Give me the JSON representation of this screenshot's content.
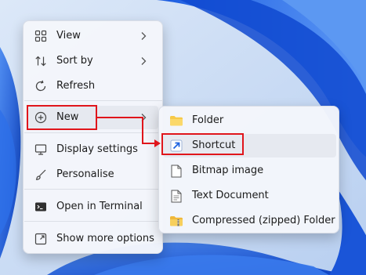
{
  "context_menu": {
    "items": [
      {
        "label": "View",
        "icon": "view-grid-icon",
        "has_submenu": true
      },
      {
        "label": "Sort by",
        "icon": "sort-arrows-icon",
        "has_submenu": true
      },
      {
        "label": "Refresh",
        "icon": "refresh-icon",
        "has_submenu": false
      },
      {
        "label": "New",
        "icon": "plus-circle-icon",
        "has_submenu": true,
        "highlighted": true
      },
      {
        "label": "Display settings",
        "icon": "display-icon",
        "has_submenu": false
      },
      {
        "label": "Personalise",
        "icon": "brush-icon",
        "has_submenu": false
      },
      {
        "label": "Open in Terminal",
        "icon": "terminal-icon",
        "has_submenu": false
      },
      {
        "label": "Show more options",
        "icon": "show-more-icon",
        "has_submenu": false
      }
    ]
  },
  "new_submenu": {
    "items": [
      {
        "label": "Folder",
        "icon": "folder-icon"
      },
      {
        "label": "Shortcut",
        "icon": "shortcut-icon",
        "highlighted": true
      },
      {
        "label": "Bitmap image",
        "icon": "bitmap-file-icon"
      },
      {
        "label": "Text Document",
        "icon": "text-file-icon"
      },
      {
        "label": "Compressed (zipped) Folder",
        "icon": "zip-folder-icon"
      }
    ]
  },
  "colors": {
    "annotation_red": "#e0151b",
    "menu_bg": "#f4f6fb",
    "highlight_bg": "#e6e9f0",
    "folder_yellow": "#f7c948",
    "wallpaper_blue": "#1f63e0"
  }
}
